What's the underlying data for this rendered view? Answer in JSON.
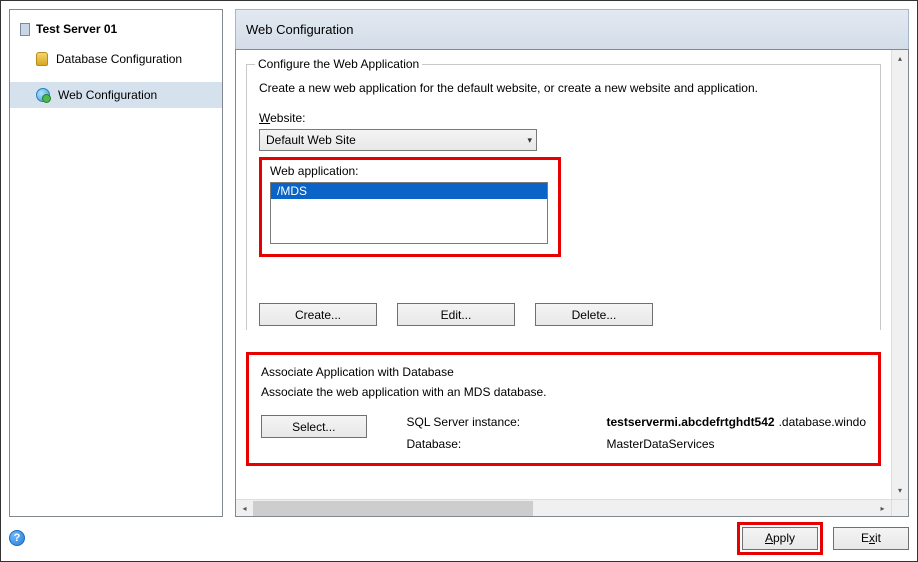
{
  "sidebar": {
    "root_label": "Test Server 01",
    "items": [
      {
        "label": "Database Configuration"
      },
      {
        "label": "Web Configuration"
      }
    ],
    "selected_index": 1
  },
  "header": {
    "title": "Web Configuration"
  },
  "configure_group": {
    "legend": "Configure the Web Application",
    "description": "Create a new web application for the default website, or create a new website and application.",
    "website_label": "Website:",
    "website_value": "Default Web Site",
    "webapp_label": "Web application:",
    "webapp_items": [
      "/MDS"
    ],
    "webapp_selected": "/MDS",
    "buttons": {
      "create": "Create...",
      "edit": "Edit...",
      "delete": "Delete..."
    }
  },
  "associate_group": {
    "legend": "Associate Application with Database",
    "description": "Associate the web application with an MDS database.",
    "select_button": "Select...",
    "sql_label": "SQL Server instance:",
    "sql_value": "testservermi.abcdefrtghdt542",
    "sql_suffix": ".database.windo",
    "db_label": "Database:",
    "db_value": "MasterDataServices"
  },
  "footer": {
    "apply": "Apply",
    "exit": "Exit"
  }
}
